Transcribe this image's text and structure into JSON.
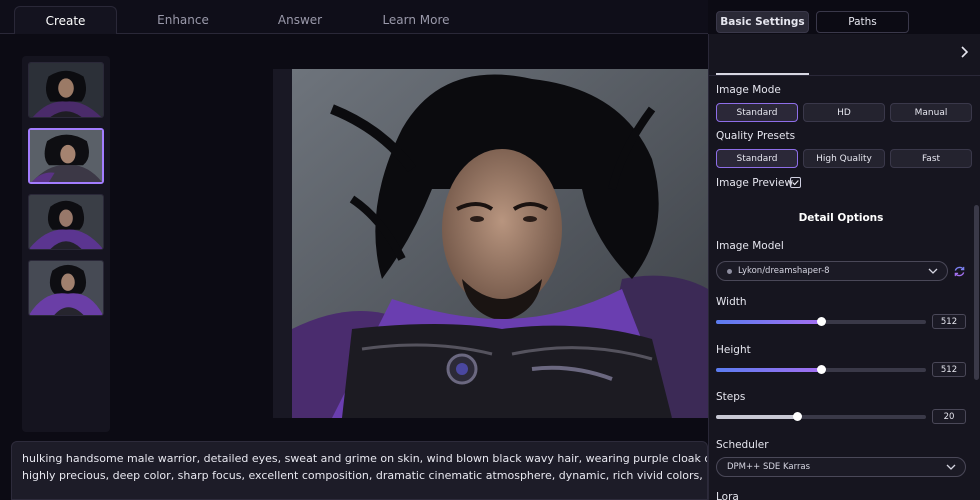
{
  "tabs": [
    "Create",
    "Enhance",
    "Answer",
    "Learn More"
  ],
  "active_tab": "Create",
  "prompt": {
    "line1": "hulking handsome male warrior, detailed eyes, sweat and grime on skin, wind blown black wavy hair, wearing purple cloak over ornate black iron armo",
    "line2": "highly precious, deep color, sharp focus, excellent composition, dramatic cinematic atmosphere, dynamic, rich vivid colors, purple glowing fog electri"
  },
  "panel": {
    "tabs": [
      "Basic Settings",
      "Paths"
    ],
    "active_tab": "Basic Settings",
    "image_mode": {
      "label": "Image Mode",
      "options": [
        "Standard",
        "HD",
        "Manual"
      ],
      "selected": "Standard"
    },
    "quality_presets": {
      "label": "Quality Presets",
      "options": [
        "Standard",
        "High Quality",
        "Fast"
      ],
      "selected": "Standard"
    },
    "image_preview": {
      "label": "Image Preview",
      "checked": true
    },
    "detail_options_title": "Detail Options",
    "image_model": {
      "label": "Image Model",
      "value": "Lykon/dreamshaper-8"
    },
    "width": {
      "label": "Width",
      "value": "512",
      "fraction": 0.5
    },
    "height": {
      "label": "Height",
      "value": "512",
      "fraction": 0.5
    },
    "steps": {
      "label": "Steps",
      "value": "20",
      "fraction": 0.385
    },
    "scheduler": {
      "label": "Scheduler",
      "value": "DPM++ SDE Karras"
    },
    "lora": {
      "label": "Lora"
    }
  },
  "thumbnails": {
    "count": 4,
    "selected_index": 1
  },
  "colors": {
    "accent": "#8e6ee8",
    "slider_start": "#5b7cf0",
    "slider_end": "#a36ff0",
    "background": "#0c0b14",
    "panel": "#16151f"
  },
  "icons": [
    "chevron-right-icon",
    "check-icon",
    "chevron-down-icon",
    "refresh-icon"
  ]
}
